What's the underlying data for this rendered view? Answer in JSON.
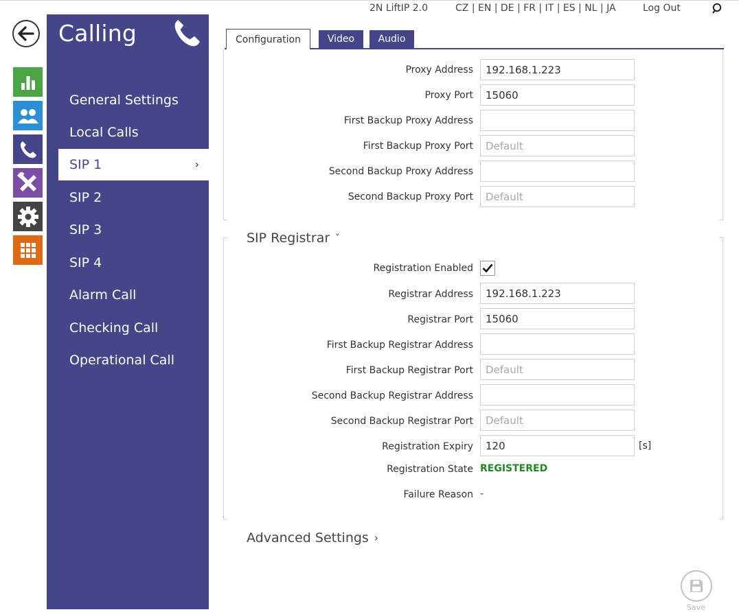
{
  "topbar": {
    "device": "2N LiftIP 2.0",
    "languages": "CZ | EN | DE | FR | IT | ES | NL | JA",
    "logout": "Log Out",
    "search_icon": "search-icon"
  },
  "rail": [
    {
      "name": "status-icon",
      "color": "#4aa545"
    },
    {
      "name": "directory-icon",
      "color": "#2b8fd3"
    },
    {
      "name": "calling-icon",
      "color": "#454689"
    },
    {
      "name": "hardware-icon",
      "color": "#7b4ea3"
    },
    {
      "name": "services-icon",
      "color": "#444444"
    },
    {
      "name": "system-icon",
      "color": "#e06a14"
    }
  ],
  "sidebar": {
    "title": "Calling",
    "items": [
      {
        "label": "General Settings"
      },
      {
        "label": "Local Calls"
      },
      {
        "label": "SIP 1",
        "chevron": "›"
      },
      {
        "label": "SIP 2"
      },
      {
        "label": "SIP 3"
      },
      {
        "label": "SIP 4"
      },
      {
        "label": "Alarm Call"
      },
      {
        "label": "Checking Call"
      },
      {
        "label": "Operational Call"
      }
    ]
  },
  "tabs": [
    "Configuration",
    "Video",
    "Audio"
  ],
  "proxy": {
    "address_label": "Proxy Address",
    "address_value": "192.168.1.223",
    "port_label": "Proxy Port",
    "port_value": "15060",
    "backup1_address_label": "First Backup Proxy Address",
    "backup1_address_value": "",
    "backup1_port_label": "First Backup Proxy Port",
    "backup1_port_placeholder": "Default",
    "backup2_address_label": "Second Backup Proxy Address",
    "backup2_address_value": "",
    "backup2_port_label": "Second Backup Proxy Port",
    "backup2_port_placeholder": "Default"
  },
  "registrar": {
    "title": "SIP Registrar",
    "chevron": "˅",
    "enabled_label": "Registration Enabled",
    "enabled": true,
    "address_label": "Registrar Address",
    "address_value": "192.168.1.223",
    "port_label": "Registrar Port",
    "port_value": "15060",
    "backup1_address_label": "First Backup Registrar Address",
    "backup1_address_value": "",
    "backup1_port_label": "First Backup Registrar Port",
    "backup1_port_placeholder": "Default",
    "backup2_address_label": "Second Backup Registrar Address",
    "backup2_address_value": "",
    "backup2_port_label": "Second Backup Registrar Port",
    "backup2_port_placeholder": "Default",
    "expiry_label": "Registration Expiry",
    "expiry_value": "120",
    "expiry_unit": "[s]",
    "state_label": "Registration State",
    "state_value": "REGISTERED",
    "state_color": "#1e8a1e",
    "failure_label": "Failure Reason",
    "failure_value": "-"
  },
  "advanced": {
    "title": "Advanced Settings",
    "chevron": "›"
  },
  "save": {
    "label": "Save"
  },
  "colors": {
    "accent": "#454689"
  }
}
